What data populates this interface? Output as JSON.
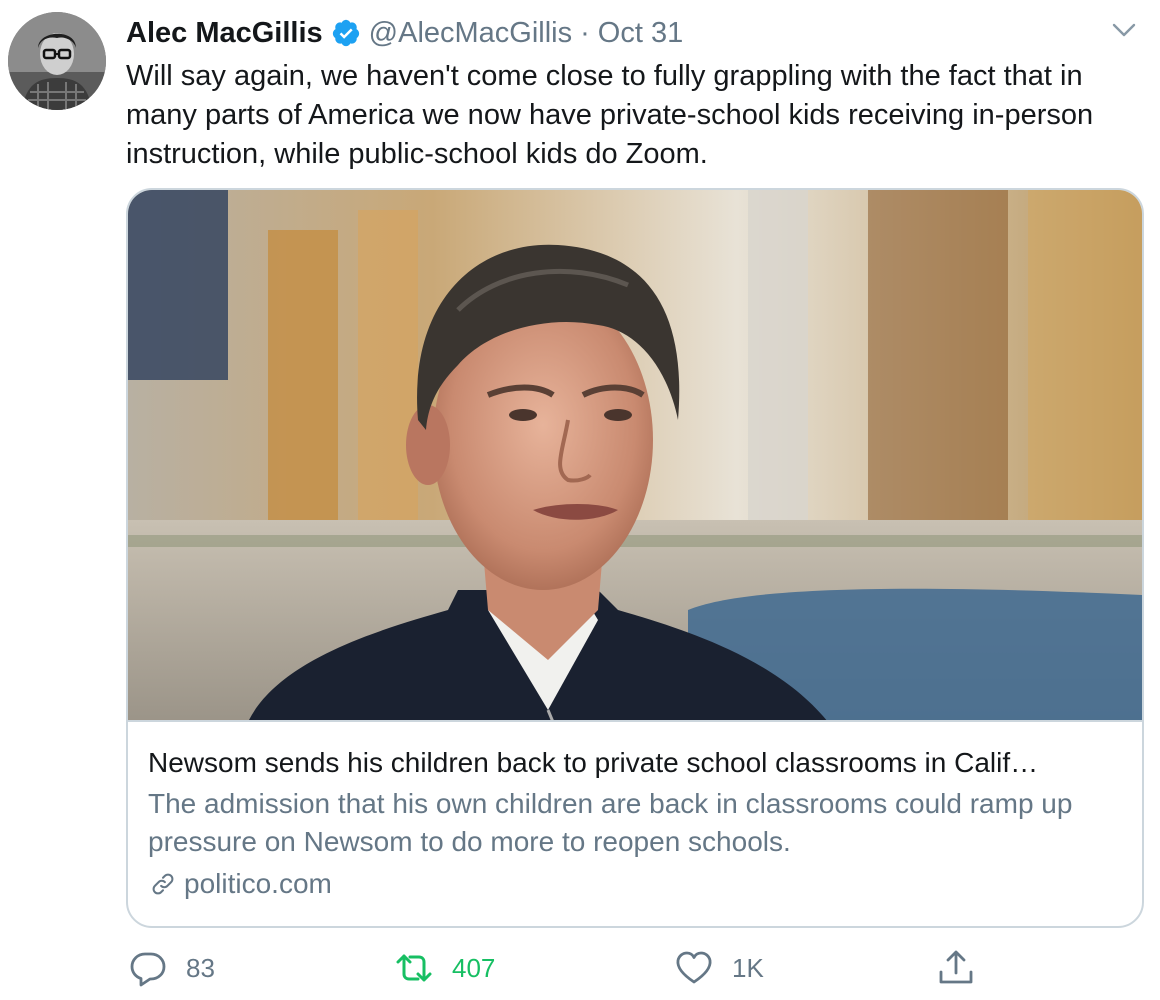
{
  "author": {
    "name": "Alec MacGillis",
    "handle": "@AlecMacGillis",
    "separator": "·",
    "date": "Oct 31",
    "verified": true,
    "avatar_icon": "avatar-photo"
  },
  "tweet": {
    "text": "Will say again, we haven't come close to fully grappling with the fact that in many parts of America we now have private-school kids receiving in-person instruction, while public-school kids do Zoom."
  },
  "card": {
    "image_icon": "article-photo",
    "title": "Newsom sends his children back to private school classrooms in Calif…",
    "description": "The admission that his own children are back in classrooms could ramp up pressure on Newsom to do more to reopen schools.",
    "domain": "politico.com",
    "domain_icon": "link-icon"
  },
  "actions": {
    "reply": {
      "icon": "reply-icon",
      "count": "83"
    },
    "retweet": {
      "icon": "retweet-icon",
      "count": "407",
      "color": "#17bf63"
    },
    "like": {
      "icon": "heart-icon",
      "count": "1K"
    },
    "share": {
      "icon": "share-icon",
      "count": ""
    }
  },
  "colors": {
    "text": "#14171a",
    "muted": "#657786",
    "border": "#ccd6dd",
    "verified": "#1da1f2",
    "retweet": "#17bf63"
  }
}
